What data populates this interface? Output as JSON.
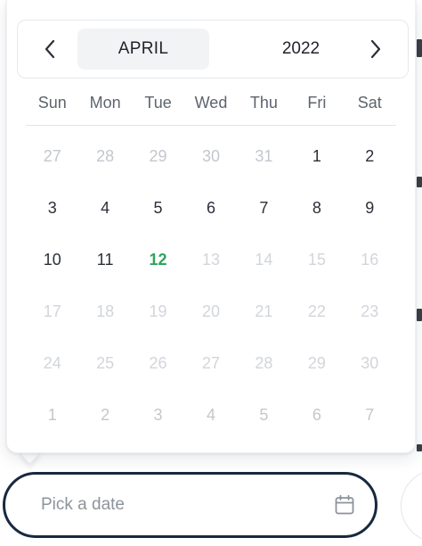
{
  "header": {
    "prev_icon": "chevron-left-icon",
    "next_icon": "chevron-right-icon",
    "month": "APRIL",
    "year": "2022"
  },
  "weekdays": [
    "Sun",
    "Mon",
    "Tue",
    "Wed",
    "Thu",
    "Fri",
    "Sat"
  ],
  "weeks": [
    [
      {
        "d": "27",
        "s": "out"
      },
      {
        "d": "28",
        "s": "out"
      },
      {
        "d": "29",
        "s": "out"
      },
      {
        "d": "30",
        "s": "out"
      },
      {
        "d": "31",
        "s": "out"
      },
      {
        "d": "1",
        "s": "in"
      },
      {
        "d": "2",
        "s": "in"
      }
    ],
    [
      {
        "d": "3",
        "s": "in"
      },
      {
        "d": "4",
        "s": "in"
      },
      {
        "d": "5",
        "s": "in"
      },
      {
        "d": "6",
        "s": "in"
      },
      {
        "d": "7",
        "s": "in"
      },
      {
        "d": "8",
        "s": "in"
      },
      {
        "d": "9",
        "s": "in"
      }
    ],
    [
      {
        "d": "10",
        "s": "in"
      },
      {
        "d": "11",
        "s": "in"
      },
      {
        "d": "12",
        "s": "today"
      },
      {
        "d": "13",
        "s": "disabled"
      },
      {
        "d": "14",
        "s": "disabled"
      },
      {
        "d": "15",
        "s": "disabled"
      },
      {
        "d": "16",
        "s": "disabled"
      }
    ],
    [
      {
        "d": "17",
        "s": "disabled"
      },
      {
        "d": "18",
        "s": "disabled"
      },
      {
        "d": "19",
        "s": "disabled"
      },
      {
        "d": "20",
        "s": "disabled"
      },
      {
        "d": "21",
        "s": "disabled"
      },
      {
        "d": "22",
        "s": "disabled"
      },
      {
        "d": "23",
        "s": "disabled"
      }
    ],
    [
      {
        "d": "24",
        "s": "disabled"
      },
      {
        "d": "25",
        "s": "disabled"
      },
      {
        "d": "26",
        "s": "disabled"
      },
      {
        "d": "27",
        "s": "disabled"
      },
      {
        "d": "28",
        "s": "disabled"
      },
      {
        "d": "29",
        "s": "disabled"
      },
      {
        "d": "30",
        "s": "disabled"
      }
    ],
    [
      {
        "d": "1",
        "s": "out"
      },
      {
        "d": "2",
        "s": "out"
      },
      {
        "d": "3",
        "s": "out"
      },
      {
        "d": "4",
        "s": "out"
      },
      {
        "d": "5",
        "s": "out"
      },
      {
        "d": "6",
        "s": "out"
      },
      {
        "d": "7",
        "s": "out"
      }
    ]
  ],
  "input": {
    "placeholder": "Pick a date",
    "icon": "calendar-icon"
  },
  "colors": {
    "today": "#2fa35a",
    "input_border": "#17293f",
    "month_highlight": "#f1f3f5"
  }
}
